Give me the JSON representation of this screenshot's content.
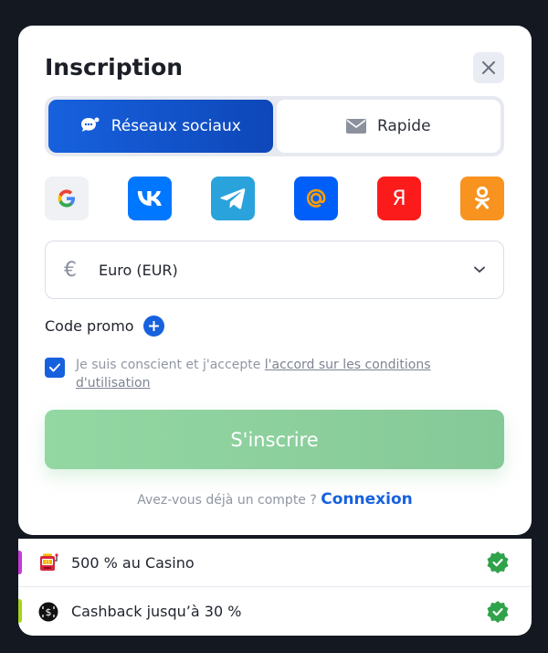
{
  "modal": {
    "title": "Inscription"
  },
  "tabs": [
    {
      "label": "Réseaux sociaux",
      "icon": "chat-bubble-icon",
      "active": true
    },
    {
      "label": "Rapide",
      "icon": "envelope-icon",
      "active": false
    }
  ],
  "social_buttons": [
    {
      "name": "Google",
      "icon": "google-icon",
      "color": "#f1f2f5"
    },
    {
      "name": "VK",
      "icon": "vk-icon",
      "color": "#0077ff"
    },
    {
      "name": "Telegram",
      "icon": "telegram-icon",
      "color": "#2aa3dc"
    },
    {
      "name": "Mail.ru",
      "icon": "at-icon",
      "color": "#005ff9"
    },
    {
      "name": "Yandex",
      "icon": "yandex-icon",
      "color": "#fc1b1b",
      "glyph": "Я"
    },
    {
      "name": "Odnoklassniki",
      "icon": "ok-icon",
      "color": "#f7931e"
    }
  ],
  "currency": {
    "symbol": "€",
    "selected": "Euro (EUR)"
  },
  "promo": {
    "label": "Code promo"
  },
  "agreement": {
    "text": "Je suis conscient et j'accepte ",
    "link": "l'accord sur les conditions d'utilisation",
    "checked": true
  },
  "submit": {
    "label": "S'inscrire"
  },
  "login": {
    "prompt": "Avez-vous déjà un compte ?",
    "link": "Connexion"
  },
  "bonuses": [
    {
      "label": "500 % au Casino",
      "icon": "slot-machine-icon",
      "accent": "#c43bd6"
    },
    {
      "label": "Cashback jusqu’à 30 %",
      "icon": "cashback-icon",
      "accent": "#a6d417"
    }
  ],
  "colors": {
    "primary": "#1761de",
    "submit": "#8dd19f",
    "success": "#2fa24a"
  }
}
